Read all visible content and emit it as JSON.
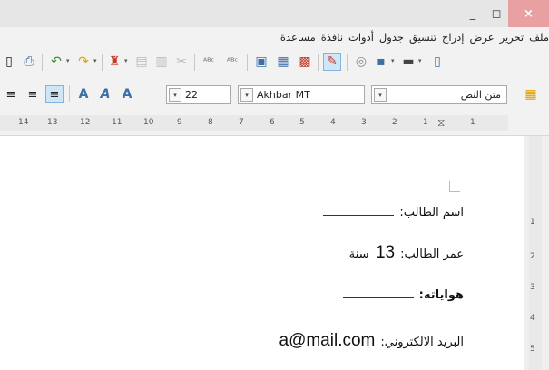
{
  "window": {
    "minimize_glyph": "_",
    "maximize_glyph": "◻",
    "close_glyph": "×"
  },
  "menu": [
    "ملف",
    "تحرير",
    "عرض",
    "إدراج",
    "تنسيق",
    "جدول",
    "أدوات",
    "نافذة",
    "مساعدة"
  ],
  "formatting": {
    "paragraph_style": "متن النص",
    "font_name": "Akhbar MT",
    "font_size": "22"
  },
  "ruler": {
    "numbers": [
      "14",
      "13",
      "12",
      "11",
      "10",
      "9",
      "8",
      "7",
      "6",
      "5",
      "4",
      "3",
      "2",
      "1",
      "1"
    ],
    "vertical_numbers": [
      "1",
      "2",
      "3",
      "4",
      "5"
    ]
  },
  "document": {
    "line1_label": "اسم الطالب:",
    "line2_label": "عمر الطالب:",
    "line2_value": "13",
    "line2_unit": "سنة",
    "line3_label": "هواياته:",
    "line4_label": "البريد الالكتروني:",
    "line4_value": "a@mail.com"
  },
  "icons": [
    "save-icon",
    "undo-icon",
    "redo-icon",
    "clone-formatting-icon",
    "paste-icon",
    "cut-icon",
    "spellcheck-icon",
    "autospell-icon",
    "navigator-icon",
    "toggle-edit-mode-icon",
    "save-toolbar-icon",
    "fontwork-icon",
    "font-color-icon",
    "align-right-icon",
    "align-center-icon",
    "align-left-icon",
    "sidebar-icon"
  ]
}
